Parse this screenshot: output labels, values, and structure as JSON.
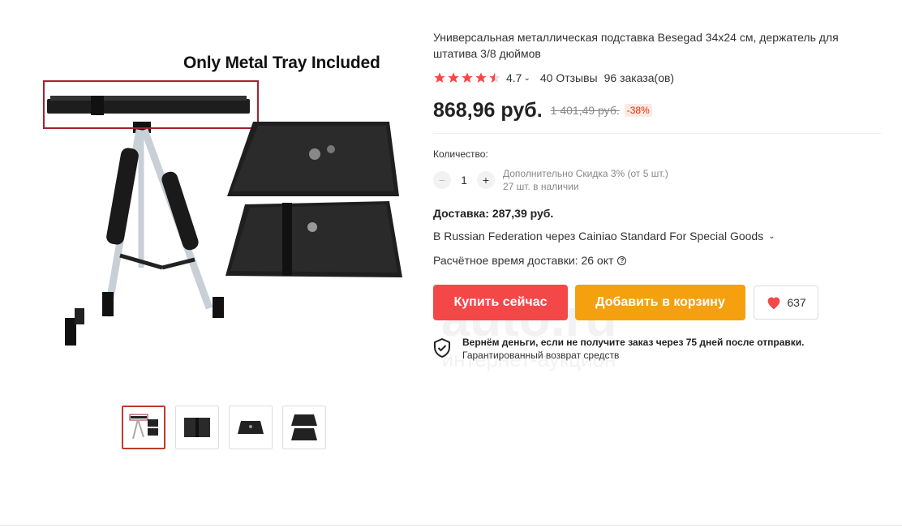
{
  "gallery": {
    "caption": "Only Metal Tray Included",
    "thumbnail_count": 4,
    "active_thumbnail": 0
  },
  "product": {
    "title": "Универсальная металлическая подставка Besegad 34x24 см, держатель для штатива 3/8 дюймов",
    "rating": "4.7",
    "stars_filled": 4.5,
    "reviews": "40 Отзывы",
    "orders": "96 заказа(ов)",
    "price": "868,96 руб.",
    "old_price": "1 401,49 руб.",
    "discount": "-38%"
  },
  "quantity": {
    "label": "Количество:",
    "minus": "−",
    "value": "1",
    "plus": "+",
    "bulk_discount": "Дополнительно Скидка 3% (от 5 шт.)",
    "in_stock": "27 шт. в наличии"
  },
  "delivery": {
    "label": "Доставка:",
    "cost": "287,39 руб.",
    "route": "В Russian Federation через Cainiao Standard For Special Goods",
    "eta_label": "Расчётное время доставки:",
    "eta_value": "26 окт"
  },
  "actions": {
    "buy_now": "Купить сейчас",
    "add_to_cart": "Добавить в корзину",
    "wishlist_count": "637"
  },
  "guarantee": {
    "main": "Вернём деньги, если не получите заказ через 75 дней после отправки.",
    "sub": "Гарантированный возврат средств"
  },
  "watermark": {
    "big": "auto.ru",
    "small": "интернет-аукцион"
  },
  "colors": {
    "buy_button": "#f44848",
    "cart_button": "#f5a00f",
    "star": "#f44848",
    "discount": "#e62e04",
    "highlight_box": "#a3222a"
  }
}
